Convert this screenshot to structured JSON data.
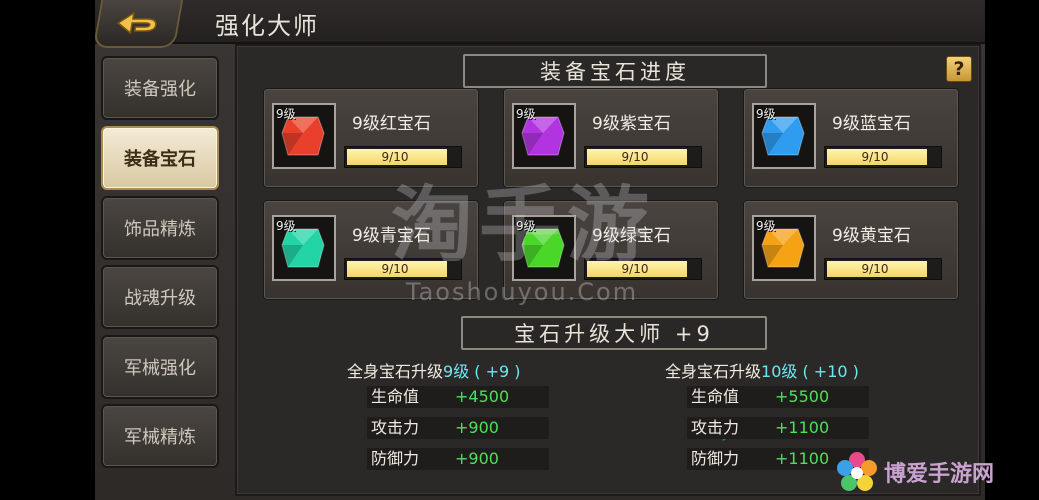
{
  "header": {
    "title": "强化大师"
  },
  "sidebar": {
    "items": [
      {
        "label": "装备强化",
        "active": false
      },
      {
        "label": "装备宝石",
        "active": true
      },
      {
        "label": "饰品精炼",
        "active": false
      },
      {
        "label": "战魂升级",
        "active": false
      },
      {
        "label": "军械强化",
        "active": false
      },
      {
        "label": "军械精炼",
        "active": false
      }
    ]
  },
  "progress_section": {
    "title": "装备宝石进度",
    "help_label": "?"
  },
  "gems": [
    {
      "level_tag": "9级",
      "name": "9级红宝石",
      "progress_text": "9/10",
      "progress": 0.9,
      "color": "#e8402a",
      "icon": "red-gem-icon"
    },
    {
      "level_tag": "9级",
      "name": "9级紫宝石",
      "progress_text": "9/10",
      "progress": 0.9,
      "color": "#b233e0",
      "icon": "purple-gem-icon"
    },
    {
      "level_tag": "9级",
      "name": "9级蓝宝石",
      "progress_text": "9/10",
      "progress": 0.9,
      "color": "#2f9cf0",
      "icon": "blue-gem-icon"
    },
    {
      "level_tag": "9级",
      "name": "9级青宝石",
      "progress_text": "9/10",
      "progress": 0.9,
      "color": "#22d4a6",
      "icon": "cyan-gem-icon"
    },
    {
      "level_tag": "9级",
      "name": "9级绿宝石",
      "progress_text": "9/10",
      "progress": 0.9,
      "color": "#4bd62a",
      "icon": "green-gem-icon"
    },
    {
      "level_tag": "9级",
      "name": "9级黄宝石",
      "progress_text": "9/10",
      "progress": 0.9,
      "color": "#f5a214",
      "icon": "yellow-gem-icon"
    }
  ],
  "master_section": {
    "title": "宝石升级大师 +9"
  },
  "current": {
    "head_prefix": "全身宝石升级",
    "head_level": "9级 ( +9 )",
    "stats": [
      {
        "label": "生命值",
        "value": "+4500"
      },
      {
        "label": "攻击力",
        "value": "+900"
      },
      {
        "label": "防御力",
        "value": "+900"
      }
    ]
  },
  "next": {
    "head_prefix": "全身宝石升级",
    "head_level": "10级 ( +10 )",
    "stats": [
      {
        "label": "生命值",
        "value": "+5500"
      },
      {
        "label": "攻击力",
        "value": "+1100"
      },
      {
        "label": "防御力",
        "value": "+1100"
      }
    ]
  },
  "watermark": {
    "main": "淘手游",
    "sub": "Taoshouyou.Com"
  },
  "site_logo": {
    "text": "博爱手游网"
  }
}
